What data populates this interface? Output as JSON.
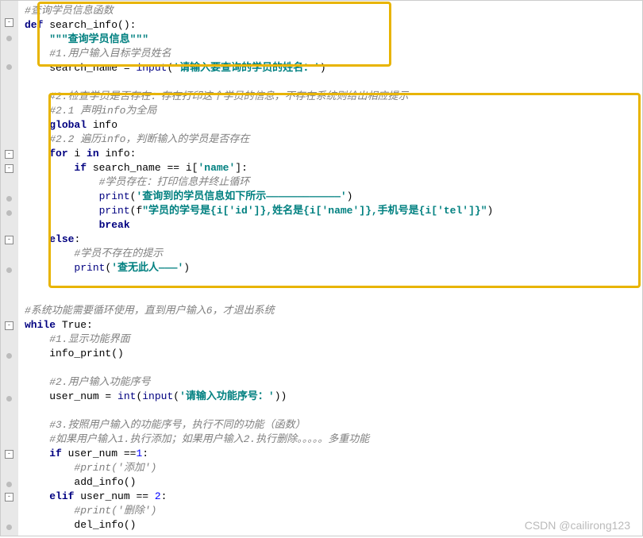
{
  "watermark": "CSDN @cailirong123",
  "code": {
    "l1": "#查询学员信息函数",
    "l2_def": "def",
    "l2_fn": " search_info():",
    "l3": "    \"\"\"查询学员信息\"\"\"",
    "l4": "    #1.用户输入目标学员姓名",
    "l5a": "    search_name = ",
    "l5b": "input",
    "l5c": "(",
    "l5d": "'请输入要查询的学员的姓名：'",
    "l5e": ")",
    "l6": "",
    "l7": "    #2.检查学员是否存在：存在打印这个学员的信息，不存在系统则给出相应提示",
    "l8": "    #2.1 声明info为全局",
    "l9a": "    ",
    "l9b": "global",
    "l9c": " info",
    "l10": "    #2.2 遍历info，判断输入的学员是否存在",
    "l11a": "    ",
    "l11b": "for",
    "l11c": " i ",
    "l11d": "in",
    "l11e": " info:",
    "l12a": "        ",
    "l12b": "if",
    "l12c": " search_name == i[",
    "l12d": "'name'",
    "l12e": "]:",
    "l13": "            #学员存在：打印信息并终止循环",
    "l14a": "            ",
    "l14b": "print",
    "l14c": "(",
    "l14d": "'查询到的学员信息如下所示————————————'",
    "l14e": ")",
    "l15a": "            ",
    "l15b": "print",
    "l15c": "(f",
    "l15d": "\"学员的学号是{i['id']},姓名是{i['name']},手机号是{i['tel']}\"",
    "l15e": ")",
    "l16a": "            ",
    "l16b": "break",
    "l17a": "    ",
    "l17b": "else",
    "l17c": ":",
    "l18": "        #学员不存在的提示",
    "l19a": "        ",
    "l19b": "print",
    "l19c": "(",
    "l19d": "'查无此人———'",
    "l19e": ")",
    "l20": "",
    "l21": "",
    "l22": "#系统功能需要循环使用，直到用户输入6，才退出系统",
    "l23a": "while",
    "l23b": " True:",
    "l24": "    #1.显示功能界面",
    "l25": "    info_print()",
    "l26": "",
    "l27": "    #2.用户输入功能序号",
    "l28a": "    user_num = ",
    "l28b": "int",
    "l28c": "(",
    "l28d": "input",
    "l28e": "(",
    "l28f": "'请输入功能序号：'",
    "l28g": "))",
    "l29": "",
    "l30": "    #3.按照用户输入的功能序号，执行不同的功能（函数）",
    "l31": "    #如果用户输入1.执行添加；如果用户输入2.执行删除。。。。。多重功能",
    "l32a": "    ",
    "l32b": "if",
    "l32c": " user_num ==",
    "l32d": "1",
    "l32e": ":",
    "l33": "        #print('添加')",
    "l34": "        add_info()",
    "l35a": "    ",
    "l35b": "elif",
    "l35c": " user_num == ",
    "l35d": "2",
    "l35e": ":",
    "l36": "        #print('删除')",
    "l37": "        del_info()"
  }
}
